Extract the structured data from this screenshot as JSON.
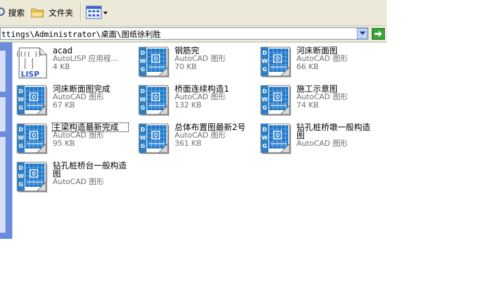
{
  "toolbar": {
    "search_label": "搜索",
    "folders_label": "文件夹"
  },
  "address": {
    "path": "ttings\\Administrator\\桌面\\图纸徐利胜"
  },
  "files": [
    {
      "name": "acad",
      "type": "AutoLISP 应用程...",
      "size": "4 KB",
      "icon": "lisp-icon"
    },
    {
      "name": "钢筋完",
      "type": "AutoCAD 图形",
      "size": "70 KB",
      "icon": "dwg-icon"
    },
    {
      "name": "河床断面图",
      "type": "AutoCAD 图形",
      "size": "66 KB",
      "icon": "dwg-icon"
    },
    {
      "name": "河床断面图完成",
      "type": "AutoCAD 图形",
      "size": "67 KB",
      "icon": "dwg-icon"
    },
    {
      "name": "桥面连续构造1",
      "type": "AutoCAD 图形",
      "size": "132 KB",
      "icon": "dwg-icon"
    },
    {
      "name": "施工示意图",
      "type": "AutoCAD 图形",
      "size": "74 KB",
      "icon": "dwg-icon"
    },
    {
      "name": "主梁构造最新完成",
      "type": "AutoCAD 图形",
      "size": "95 KB",
      "icon": "dwg-icon"
    },
    {
      "name": "总体布置图最新2号",
      "type": "AutoCAD 图形",
      "size": "361 KB",
      "icon": "dwg-icon"
    },
    {
      "name": "钻孔桩桥墩一般构造图",
      "type": "AutoCAD 图形",
      "size": "",
      "icon": "dwg-icon"
    },
    {
      "name": "钻孔桩桥台一般构造图",
      "type": "AutoCAD 图形",
      "size": "",
      "icon": "dwg-icon"
    }
  ]
}
